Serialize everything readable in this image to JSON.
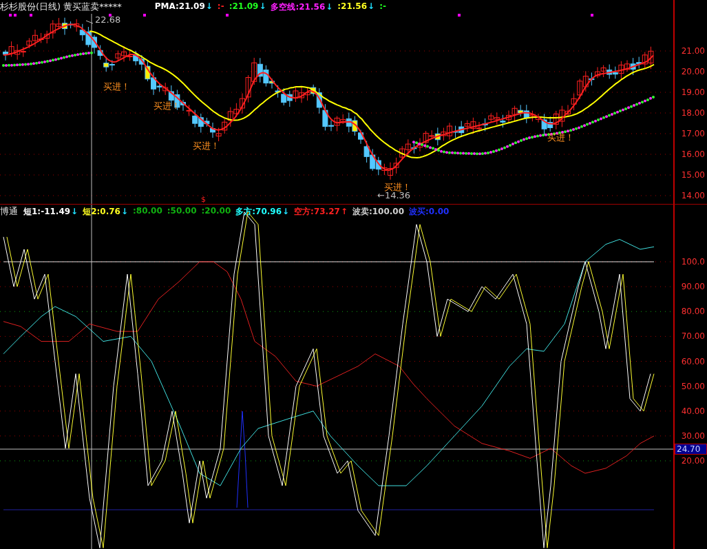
{
  "price_panel": {
    "title": "杉杉股份(日线) 黄买蓝卖*****",
    "legend": [
      {
        "text": "PMA:21.09",
        "arrow": "↓",
        "color": "#ffffff"
      },
      {
        "text": ":-",
        "color": "#ff2020"
      },
      {
        "text": ":21.09",
        "arrow": "↓",
        "color": "#20ff20"
      },
      {
        "text": "多空线:21.56",
        "arrow": "↓",
        "color": "#ff20ff"
      },
      {
        "text": ":21.56",
        "arrow": "↓",
        "color": "#ffff20"
      },
      {
        "text": ":-",
        "color": "#20ff20"
      }
    ],
    "axis_labels": [
      "21.00",
      "20.00",
      "19.00",
      "18.00",
      "17.00",
      "16.00",
      "15.00",
      "14.00"
    ],
    "high_label": "22.68",
    "low_label": "←14.36",
    "annotations": [
      "买进！",
      "买进！",
      "买进！",
      "买进！",
      "买进！"
    ]
  },
  "indicator_panel": {
    "title": "博通",
    "legend": [
      {
        "text": "短1:-11.49",
        "arrow": "↓",
        "color": "#ffffff"
      },
      {
        "text": "短2:0.76",
        "arrow": "↓",
        "color": "#ffff20"
      },
      {
        "text": ":80.00",
        "color": "#10b010"
      },
      {
        "text": ":50.00",
        "color": "#10b010"
      },
      {
        "text": ":20.00",
        "color": "#10b010"
      },
      {
        "text": "多方:70.96",
        "arrow": "↓",
        "color": "#20ffff"
      },
      {
        "text": "空方:73.27",
        "arrow": "↑",
        "color": "#ff2020"
      },
      {
        "text": "波卖:100.00",
        "color": "#d0d0d0"
      },
      {
        "text": "波买:0.00",
        "color": "#2030ff"
      }
    ],
    "signal_mark": "$",
    "axis_labels": [
      "100.0",
      "90.00",
      "80.00",
      "70.00",
      "60.00",
      "50.00",
      "40.00",
      "30.00",
      "20.00"
    ],
    "current_value": "24.70"
  }
}
